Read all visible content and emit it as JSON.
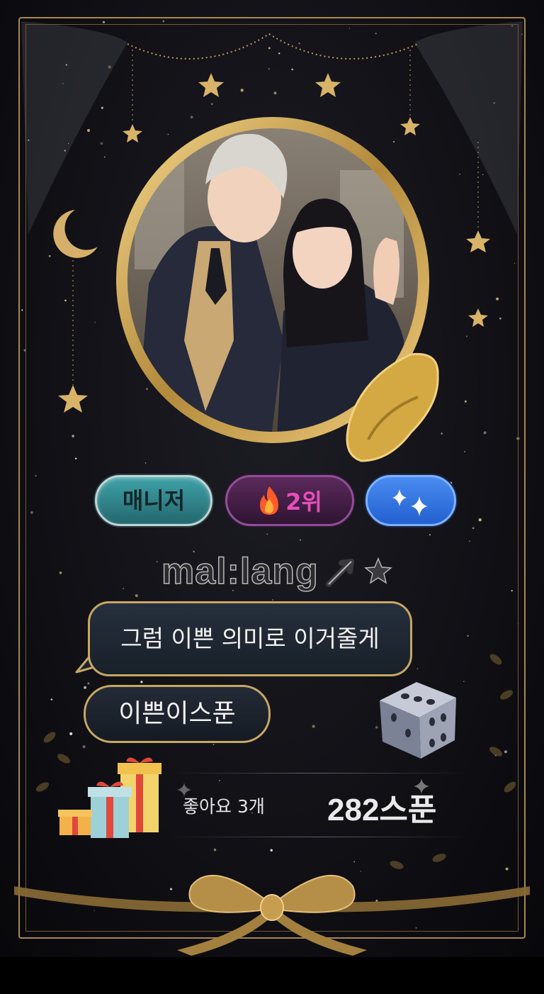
{
  "card": {
    "role_badge": "매니저",
    "rank_badge": "2위",
    "rank_icon": "fire-icon",
    "sparkle_icon": "sparkles-icon",
    "username": "mal:lang",
    "message": "그럼 이쁜 의미로 이거줄게",
    "item_name": "이쁜이스푼",
    "likes": "좋아요 3개",
    "points": "282스푼"
  },
  "colors": {
    "gold": "#c7a765",
    "role_teal": "#2f8a90",
    "rank_purple": "#4a2150",
    "rank_text": "#e64fb8",
    "spark_blue": "#3a78e6"
  }
}
